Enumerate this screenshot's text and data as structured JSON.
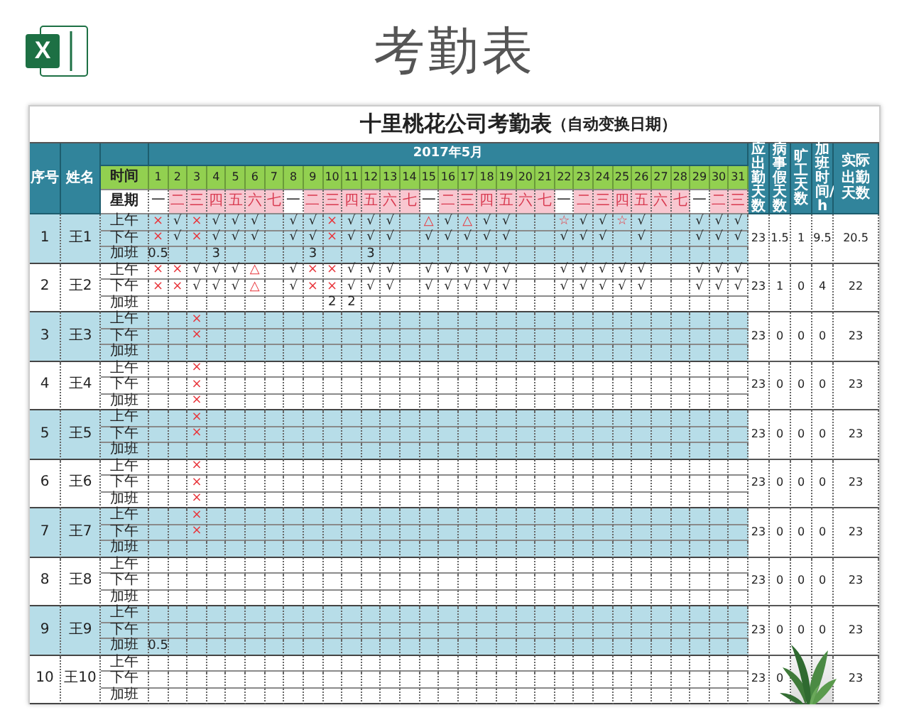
{
  "banner": {
    "logo_letter": "X",
    "title": "考勤表"
  },
  "sheet": {
    "title": "十里桃花公司考勤表",
    "subtitle": "（自动变换日期）",
    "month": "2017年5月",
    "headers": {
      "seq": "序号",
      "name": "姓名",
      "time": "时间",
      "weekday": "星期"
    },
    "summary_headers": [
      {
        "label": "应出勤天数",
        "vertical": true
      },
      {
        "label": "病事假天数",
        "vertical": true
      },
      {
        "label": "旷工天数",
        "vertical": true
      },
      {
        "label": "加班时间/h",
        "vertical": true
      },
      {
        "label": "实际出勤天数",
        "vertical": false
      }
    ],
    "days": [
      "1",
      "2",
      "3",
      "4",
      "5",
      "6",
      "7",
      "8",
      "9",
      "10",
      "11",
      "12",
      "13",
      "14",
      "15",
      "16",
      "17",
      "18",
      "19",
      "20",
      "21",
      "22",
      "23",
      "24",
      "25",
      "26",
      "27",
      "28",
      "29",
      "30",
      "31"
    ],
    "weekdays": [
      {
        "label": "一",
        "highlighted": false
      },
      {
        "label": "二",
        "highlighted": true
      },
      {
        "label": "三",
        "highlighted": true
      },
      {
        "label": "四",
        "highlighted": true
      },
      {
        "label": "五",
        "highlighted": true
      },
      {
        "label": "六",
        "highlighted": true
      },
      {
        "label": "七",
        "highlighted": true
      },
      {
        "label": "一",
        "highlighted": false
      },
      {
        "label": "二",
        "highlighted": true
      },
      {
        "label": "三",
        "highlighted": true
      },
      {
        "label": "四",
        "highlighted": true
      },
      {
        "label": "五",
        "highlighted": true
      },
      {
        "label": "六",
        "highlighted": true
      },
      {
        "label": "七",
        "highlighted": true
      },
      {
        "label": "一",
        "highlighted": false
      },
      {
        "label": "二",
        "highlighted": true
      },
      {
        "label": "三",
        "highlighted": true
      },
      {
        "label": "四",
        "highlighted": true
      },
      {
        "label": "五",
        "highlighted": true
      },
      {
        "label": "六",
        "highlighted": true
      },
      {
        "label": "七",
        "highlighted": true
      },
      {
        "label": "一",
        "highlighted": false
      },
      {
        "label": "二",
        "highlighted": true
      },
      {
        "label": "三",
        "highlighted": true
      },
      {
        "label": "四",
        "highlighted": true
      },
      {
        "label": "五",
        "highlighted": true
      },
      {
        "label": "六",
        "highlighted": true
      },
      {
        "label": "七",
        "highlighted": true
      },
      {
        "label": "一",
        "highlighted": false
      },
      {
        "label": "二",
        "highlighted": true
      },
      {
        "label": "三",
        "highlighted": true
      }
    ],
    "employees": [
      {
        "seq": "1",
        "name": "王1",
        "shaded": true,
        "summary": [
          "23",
          "1.5",
          "1",
          "9.5",
          "20.5"
        ],
        "rows": [
          {
            "label": "上午",
            "cells": [
              {
                "t": "×",
                "alert": true
              },
              {
                "t": "√",
                "alert": false
              },
              {
                "t": "×",
                "alert": true
              },
              {
                "t": "√",
                "alert": false
              },
              {
                "t": "√",
                "alert": false
              },
              {
                "t": "√",
                "alert": false
              },
              null,
              {
                "t": "√",
                "alert": false
              },
              {
                "t": "√",
                "alert": false
              },
              {
                "t": "×",
                "alert": true
              },
              {
                "t": "√",
                "alert": false
              },
              {
                "t": "√",
                "alert": false
              },
              {
                "t": "√",
                "alert": false
              },
              null,
              {
                "t": "△",
                "alert": true
              },
              {
                "t": "√",
                "alert": false
              },
              {
                "t": "△",
                "alert": true
              },
              {
                "t": "√",
                "alert": false
              },
              {
                "t": "√",
                "alert": false
              },
              null,
              null,
              {
                "t": "☆",
                "alert": true
              },
              {
                "t": "√",
                "alert": false
              },
              {
                "t": "√",
                "alert": false
              },
              {
                "t": "☆",
                "alert": true
              },
              {
                "t": "√",
                "alert": false
              },
              null,
              null,
              {
                "t": "√",
                "alert": false
              },
              {
                "t": "√",
                "alert": false
              },
              {
                "t": "√",
                "alert": false
              }
            ]
          },
          {
            "label": "下午",
            "cells": [
              {
                "t": "×",
                "alert": true
              },
              {
                "t": "√",
                "alert": false
              },
              {
                "t": "×",
                "alert": true
              },
              {
                "t": "√",
                "alert": false
              },
              {
                "t": "√",
                "alert": false
              },
              {
                "t": "√",
                "alert": false
              },
              null,
              {
                "t": "√",
                "alert": false
              },
              {
                "t": "√",
                "alert": false
              },
              {
                "t": "×",
                "alert": true
              },
              {
                "t": "√",
                "alert": false
              },
              {
                "t": "√",
                "alert": false
              },
              {
                "t": "√",
                "alert": false
              },
              null,
              {
                "t": "√",
                "alert": false
              },
              {
                "t": "√",
                "alert": false
              },
              {
                "t": "√",
                "alert": false
              },
              {
                "t": "√",
                "alert": false
              },
              {
                "t": "√",
                "alert": false
              },
              null,
              null,
              {
                "t": "√",
                "alert": false
              },
              {
                "t": "√",
                "alert": false
              },
              {
                "t": "√",
                "alert": false
              },
              null,
              {
                "t": "√",
                "alert": false
              },
              null,
              null,
              {
                "t": "√",
                "alert": false
              },
              {
                "t": "√",
                "alert": false
              },
              {
                "t": "√",
                "alert": false
              }
            ]
          },
          {
            "label": "加班",
            "cells": [
              {
                "t": "0.5",
                "alert": false
              },
              null,
              null,
              {
                "t": "3",
                "alert": false
              },
              null,
              null,
              null,
              null,
              {
                "t": "3",
                "alert": false
              },
              null,
              null,
              {
                "t": "3",
                "alert": false
              },
              null,
              null,
              null,
              null,
              null,
              null,
              null,
              null,
              null,
              null,
              null,
              null,
              null,
              null,
              null,
              null,
              null,
              null,
              null
            ]
          }
        ]
      },
      {
        "seq": "2",
        "name": "王2",
        "shaded": false,
        "summary": [
          "23",
          "1",
          "0",
          "4",
          "22"
        ],
        "rows": [
          {
            "label": "上午",
            "cells": [
              {
                "t": "×",
                "alert": true
              },
              {
                "t": "×",
                "alert": true
              },
              {
                "t": "√",
                "alert": false
              },
              {
                "t": "√",
                "alert": false
              },
              {
                "t": "√",
                "alert": false
              },
              {
                "t": "△",
                "alert": true
              },
              null,
              {
                "t": "√",
                "alert": false
              },
              {
                "t": "×",
                "alert": true
              },
              {
                "t": "×",
                "alert": true
              },
              {
                "t": "√",
                "alert": false
              },
              {
                "t": "√",
                "alert": false
              },
              {
                "t": "√",
                "alert": false
              },
              null,
              {
                "t": "√",
                "alert": false
              },
              {
                "t": "√",
                "alert": false
              },
              {
                "t": "√",
                "alert": false
              },
              {
                "t": "√",
                "alert": false
              },
              {
                "t": "√",
                "alert": false
              },
              null,
              null,
              {
                "t": "√",
                "alert": false
              },
              {
                "t": "√",
                "alert": false
              },
              {
                "t": "√",
                "alert": false
              },
              {
                "t": "√",
                "alert": false
              },
              {
                "t": "√",
                "alert": false
              },
              null,
              null,
              {
                "t": "√",
                "alert": false
              },
              {
                "t": "√",
                "alert": false
              },
              {
                "t": "√",
                "alert": false
              }
            ]
          },
          {
            "label": "下午",
            "cells": [
              {
                "t": "×",
                "alert": true
              },
              {
                "t": "×",
                "alert": true
              },
              {
                "t": "√",
                "alert": false
              },
              {
                "t": "√",
                "alert": false
              },
              {
                "t": "√",
                "alert": false
              },
              {
                "t": "△",
                "alert": true
              },
              null,
              {
                "t": "√",
                "alert": false
              },
              {
                "t": "×",
                "alert": true
              },
              {
                "t": "×",
                "alert": true
              },
              {
                "t": "√",
                "alert": false
              },
              {
                "t": "√",
                "alert": false
              },
              {
                "t": "√",
                "alert": false
              },
              null,
              {
                "t": "√",
                "alert": false
              },
              {
                "t": "√",
                "alert": false
              },
              {
                "t": "√",
                "alert": false
              },
              {
                "t": "√",
                "alert": false
              },
              {
                "t": "√",
                "alert": false
              },
              null,
              null,
              {
                "t": "√",
                "alert": false
              },
              {
                "t": "√",
                "alert": false
              },
              {
                "t": "√",
                "alert": false
              },
              {
                "t": "√",
                "alert": false
              },
              {
                "t": "√",
                "alert": false
              },
              null,
              null,
              {
                "t": "√",
                "alert": false
              },
              {
                "t": "√",
                "alert": false
              },
              {
                "t": "√",
                "alert": false
              }
            ]
          },
          {
            "label": "加班",
            "cells": [
              null,
              null,
              null,
              null,
              null,
              null,
              null,
              null,
              null,
              {
                "t": "2",
                "alert": false
              },
              {
                "t": "2",
                "alert": false
              },
              null,
              null,
              null,
              null,
              null,
              null,
              null,
              null,
              null,
              null,
              null,
              null,
              null,
              null,
              null,
              null,
              null,
              null,
              null,
              null
            ]
          }
        ]
      },
      {
        "seq": "3",
        "name": "王3",
        "shaded": true,
        "summary": [
          "23",
          "0",
          "0",
          "0",
          "23"
        ],
        "rows": [
          {
            "label": "上午",
            "cells": [
              null,
              null,
              {
                "t": "×",
                "alert": true
              },
              null,
              null,
              null,
              null,
              null,
              null,
              null,
              null,
              null,
              null,
              null,
              null,
              null,
              null,
              null,
              null,
              null,
              null,
              null,
              null,
              null,
              null,
              null,
              null,
              null,
              null,
              null,
              null
            ]
          },
          {
            "label": "下午",
            "cells": [
              null,
              null,
              {
                "t": "×",
                "alert": true
              },
              null,
              null,
              null,
              null,
              null,
              null,
              null,
              null,
              null,
              null,
              null,
              null,
              null,
              null,
              null,
              null,
              null,
              null,
              null,
              null,
              null,
              null,
              null,
              null,
              null,
              null,
              null,
              null
            ]
          },
          {
            "label": "加班",
            "cells": [
              null,
              null,
              null,
              null,
              null,
              null,
              null,
              null,
              null,
              null,
              null,
              null,
              null,
              null,
              null,
              null,
              null,
              null,
              null,
              null,
              null,
              null,
              null,
              null,
              null,
              null,
              null,
              null,
              null,
              null,
              null
            ]
          }
        ]
      },
      {
        "seq": "4",
        "name": "王4",
        "shaded": false,
        "summary": [
          "23",
          "0",
          "0",
          "0",
          "23"
        ],
        "rows": [
          {
            "label": "上午",
            "cells": [
              null,
              null,
              {
                "t": "×",
                "alert": true
              },
              null,
              null,
              null,
              null,
              null,
              null,
              null,
              null,
              null,
              null,
              null,
              null,
              null,
              null,
              null,
              null,
              null,
              null,
              null,
              null,
              null,
              null,
              null,
              null,
              null,
              null,
              null,
              null
            ]
          },
          {
            "label": "下午",
            "cells": [
              null,
              null,
              {
                "t": "×",
                "alert": true
              },
              null,
              null,
              null,
              null,
              null,
              null,
              null,
              null,
              null,
              null,
              null,
              null,
              null,
              null,
              null,
              null,
              null,
              null,
              null,
              null,
              null,
              null,
              null,
              null,
              null,
              null,
              null,
              null
            ]
          },
          {
            "label": "加班",
            "cells": [
              null,
              null,
              {
                "t": "×",
                "alert": true
              },
              null,
              null,
              null,
              null,
              null,
              null,
              null,
              null,
              null,
              null,
              null,
              null,
              null,
              null,
              null,
              null,
              null,
              null,
              null,
              null,
              null,
              null,
              null,
              null,
              null,
              null,
              null,
              null
            ]
          }
        ]
      },
      {
        "seq": "5",
        "name": "王5",
        "shaded": true,
        "summary": [
          "23",
          "0",
          "0",
          "0",
          "23"
        ],
        "rows": [
          {
            "label": "上午",
            "cells": [
              null,
              null,
              {
                "t": "×",
                "alert": true
              },
              null,
              null,
              null,
              null,
              null,
              null,
              null,
              null,
              null,
              null,
              null,
              null,
              null,
              null,
              null,
              null,
              null,
              null,
              null,
              null,
              null,
              null,
              null,
              null,
              null,
              null,
              null,
              null
            ]
          },
          {
            "label": "下午",
            "cells": [
              null,
              null,
              {
                "t": "×",
                "alert": true
              },
              null,
              null,
              null,
              null,
              null,
              null,
              null,
              null,
              null,
              null,
              null,
              null,
              null,
              null,
              null,
              null,
              null,
              null,
              null,
              null,
              null,
              null,
              null,
              null,
              null,
              null,
              null,
              null
            ]
          },
          {
            "label": "加班",
            "cells": [
              null,
              null,
              null,
              null,
              null,
              null,
              null,
              null,
              null,
              null,
              null,
              null,
              null,
              null,
              null,
              null,
              null,
              null,
              null,
              null,
              null,
              null,
              null,
              null,
              null,
              null,
              null,
              null,
              null,
              null,
              null
            ]
          }
        ]
      },
      {
        "seq": "6",
        "name": "王6",
        "shaded": false,
        "summary": [
          "23",
          "0",
          "0",
          "0",
          "23"
        ],
        "rows": [
          {
            "label": "上午",
            "cells": [
              null,
              null,
              {
                "t": "×",
                "alert": true
              },
              null,
              null,
              null,
              null,
              null,
              null,
              null,
              null,
              null,
              null,
              null,
              null,
              null,
              null,
              null,
              null,
              null,
              null,
              null,
              null,
              null,
              null,
              null,
              null,
              null,
              null,
              null,
              null
            ]
          },
          {
            "label": "下午",
            "cells": [
              null,
              null,
              {
                "t": "×",
                "alert": true
              },
              null,
              null,
              null,
              null,
              null,
              null,
              null,
              null,
              null,
              null,
              null,
              null,
              null,
              null,
              null,
              null,
              null,
              null,
              null,
              null,
              null,
              null,
              null,
              null,
              null,
              null,
              null,
              null
            ]
          },
          {
            "label": "加班",
            "cells": [
              null,
              null,
              {
                "t": "×",
                "alert": true
              },
              null,
              null,
              null,
              null,
              null,
              null,
              null,
              null,
              null,
              null,
              null,
              null,
              null,
              null,
              null,
              null,
              null,
              null,
              null,
              null,
              null,
              null,
              null,
              null,
              null,
              null,
              null,
              null
            ]
          }
        ]
      },
      {
        "seq": "7",
        "name": "王7",
        "shaded": true,
        "summary": [
          "23",
          "0",
          "0",
          "0",
          "23"
        ],
        "rows": [
          {
            "label": "上午",
            "cells": [
              null,
              null,
              {
                "t": "×",
                "alert": true
              },
              null,
              null,
              null,
              null,
              null,
              null,
              null,
              null,
              null,
              null,
              null,
              null,
              null,
              null,
              null,
              null,
              null,
              null,
              null,
              null,
              null,
              null,
              null,
              null,
              null,
              null,
              null,
              null
            ]
          },
          {
            "label": "下午",
            "cells": [
              null,
              null,
              {
                "t": "×",
                "alert": true
              },
              null,
              null,
              null,
              null,
              null,
              null,
              null,
              null,
              null,
              null,
              null,
              null,
              null,
              null,
              null,
              null,
              null,
              null,
              null,
              null,
              null,
              null,
              null,
              null,
              null,
              null,
              null,
              null
            ]
          },
          {
            "label": "加班",
            "cells": [
              null,
              null,
              null,
              null,
              null,
              null,
              null,
              null,
              null,
              null,
              null,
              null,
              null,
              null,
              null,
              null,
              null,
              null,
              null,
              null,
              null,
              null,
              null,
              null,
              null,
              null,
              null,
              null,
              null,
              null,
              null
            ]
          }
        ]
      },
      {
        "seq": "8",
        "name": "王8",
        "shaded": false,
        "summary": [
          "23",
          "0",
          "0",
          "0",
          "23"
        ],
        "rows": [
          {
            "label": "上午",
            "cells": [
              null,
              null,
              null,
              null,
              null,
              null,
              null,
              null,
              null,
              null,
              null,
              null,
              null,
              null,
              null,
              null,
              null,
              null,
              null,
              null,
              null,
              null,
              null,
              null,
              null,
              null,
              null,
              null,
              null,
              null,
              null
            ]
          },
          {
            "label": "下午",
            "cells": [
              null,
              null,
              null,
              null,
              null,
              null,
              null,
              null,
              null,
              null,
              null,
              null,
              null,
              null,
              null,
              null,
              null,
              null,
              null,
              null,
              null,
              null,
              null,
              null,
              null,
              null,
              null,
              null,
              null,
              null,
              null
            ]
          },
          {
            "label": "加班",
            "cells": [
              null,
              null,
              null,
              null,
              null,
              null,
              null,
              null,
              null,
              null,
              null,
              null,
              null,
              null,
              null,
              null,
              null,
              null,
              null,
              null,
              null,
              null,
              null,
              null,
              null,
              null,
              null,
              null,
              null,
              null,
              null
            ]
          }
        ]
      },
      {
        "seq": "9",
        "name": "王9",
        "shaded": true,
        "summary": [
          "23",
          "0",
          "0",
          "0",
          "23"
        ],
        "rows": [
          {
            "label": "上午",
            "cells": [
              null,
              null,
              null,
              null,
              null,
              null,
              null,
              null,
              null,
              null,
              null,
              null,
              null,
              null,
              null,
              null,
              null,
              null,
              null,
              null,
              null,
              null,
              null,
              null,
              null,
              null,
              null,
              null,
              null,
              null,
              null
            ]
          },
          {
            "label": "下午",
            "cells": [
              null,
              null,
              null,
              null,
              null,
              null,
              null,
              null,
              null,
              null,
              null,
              null,
              null,
              null,
              null,
              null,
              null,
              null,
              null,
              null,
              null,
              null,
              null,
              null,
              null,
              null,
              null,
              null,
              null,
              null,
              null
            ]
          },
          {
            "label": "加班",
            "cells": [
              {
                "t": "0.5",
                "alert": false
              },
              null,
              null,
              null,
              null,
              null,
              null,
              null,
              null,
              null,
              null,
              null,
              null,
              null,
              null,
              null,
              null,
              null,
              null,
              null,
              null,
              null,
              null,
              null,
              null,
              null,
              null,
              null,
              null,
              null,
              null
            ]
          }
        ]
      },
      {
        "seq": "10",
        "name": "王10",
        "shaded": false,
        "summary": [
          {
            "value": "23",
            "covered": false
          },
          {
            "value": "0",
            "covered": false
          },
          {
            "covered": true
          },
          {
            "covered": true
          },
          {
            "value": "23",
            "covered": false
          }
        ],
        "rows": [
          {
            "label": "上午",
            "cells": [
              null,
              null,
              null,
              null,
              null,
              null,
              null,
              null,
              null,
              null,
              null,
              null,
              null,
              null,
              null,
              null,
              null,
              null,
              null,
              null,
              null,
              null,
              null,
              null,
              null,
              null,
              null,
              null,
              null,
              null,
              null
            ]
          },
          {
            "label": "下午",
            "cells": [
              null,
              null,
              null,
              null,
              null,
              null,
              null,
              null,
              null,
              null,
              null,
              null,
              null,
              null,
              null,
              null,
              null,
              null,
              null,
              null,
              null,
              null,
              null,
              null,
              null,
              null,
              null,
              null,
              null,
              null,
              null
            ]
          },
          {
            "label": "加班",
            "cells": [
              null,
              null,
              null,
              null,
              null,
              null,
              null,
              null,
              null,
              null,
              null,
              null,
              null,
              null,
              null,
              null,
              null,
              null,
              null,
              null,
              null,
              null,
              null,
              null,
              null,
              null,
              null,
              null,
              null,
              null,
              null
            ]
          }
        ]
      }
    ]
  }
}
